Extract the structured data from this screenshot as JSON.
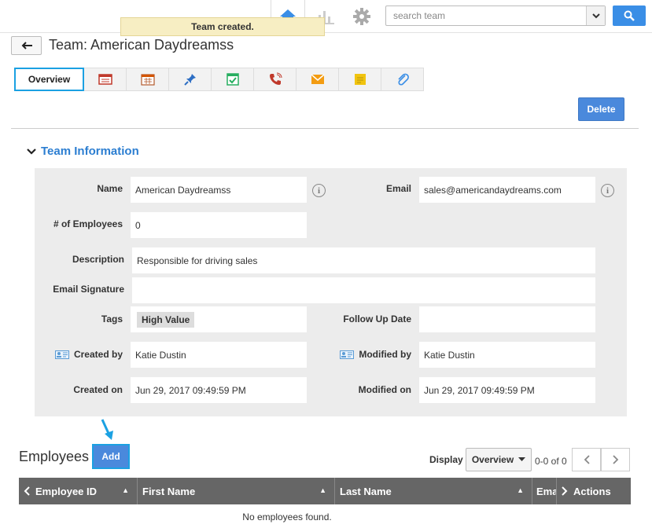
{
  "topbar": {
    "home_icon": "home-icon",
    "chart_icon": "bar-chart-icon",
    "gear_icon": "gear-icon",
    "search_placeholder": "search team",
    "search_button_icon": "search-icon"
  },
  "toast": {
    "message": "Team created."
  },
  "header": {
    "back_icon": "back-arrow-icon",
    "title": "Team: American Daydreamss"
  },
  "tabs": {
    "active_label": "Overview",
    "icons": [
      "notes-icon",
      "calendar-icon",
      "pin-icon",
      "task-icon",
      "phone-icon",
      "email-icon",
      "sticky-note-icon",
      "attachment-icon"
    ]
  },
  "actions": {
    "delete_label": "Delete"
  },
  "team_info": {
    "section_title": "Team Information",
    "name_label": "Name",
    "name_value": "American Daydreamss",
    "email_label": "Email",
    "email_value": "sales@americandaydreams.com",
    "employees_label": "# of Employees",
    "employees_value": "0",
    "description_label": "Description",
    "description_value": "Responsible for driving sales",
    "signature_label": "Email Signature",
    "signature_value": "",
    "tags_label": "Tags",
    "tag_value": "High Value",
    "followup_label": "Follow Up Date",
    "followup_value": "",
    "created_by_label": "Created by",
    "created_by_value": "Katie Dustin",
    "modified_by_label": "Modified by",
    "modified_by_value": "Katie Dustin",
    "created_on_label": "Created on",
    "created_on_value": "Jun 29, 2017 09:49:59 PM",
    "modified_on_label": "Modified on",
    "modified_on_value": "Jun 29, 2017 09:49:59 PM"
  },
  "employees": {
    "title": "Employees",
    "add_label": "Add",
    "display_label": "Display",
    "display_value": "Overview",
    "pager_text": "0-0 of 0",
    "columns": [
      "Employee ID",
      "First Name",
      "Last Name",
      "Ema",
      "Actions"
    ],
    "empty_message": "No employees found."
  },
  "colors": {
    "accent": "#4a89dc",
    "highlight": "#1ba1e2",
    "section_title": "#2c7ed1",
    "toast_bg": "#f7eec3"
  }
}
